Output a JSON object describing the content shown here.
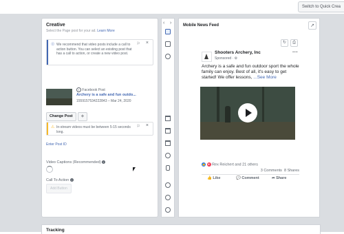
{
  "topbar": {
    "switch_label": "Switch to Quick Crea"
  },
  "creative": {
    "title": "Creative",
    "subtitle": "Select the Page post for your ad.",
    "learn_more": "Learn More",
    "recommend_notice": "We recommend that video posts include a call to action button. You can select an existing post that has a call to action, or create a new video post.",
    "post": {
      "source": "Facebook Post",
      "title": "Archery is a safe and fun outdo...",
      "meta": "1559157534222843 – Mar 24, 2020"
    },
    "change_post": "Change Post",
    "add": "+",
    "instream_notice": "In-stream videos must be between 5-15 seconds long.",
    "enter_post_id": "Enter Post ID",
    "video_captions": "Video Captions (Recommended)",
    "call_to_action": "Call To Action",
    "add_button": "Add Button"
  },
  "preview": {
    "title": "Mobile News Feed",
    "page_name": "Shooters Archery, Inc",
    "sponsored": "Sponsored · ⚙",
    "text": "Archery is a safe and fun outdoor sport the whole family can enjoy. Best of all, it's easy to get started! We offer lessons,",
    "see_more": "...See More",
    "reactions": "Rex Reichert and 21 others",
    "comments": "3 Comments",
    "shares": "8 Shares",
    "like": "Like",
    "comment": "Comment",
    "share": "Share"
  },
  "tracking": {
    "title": "Tracking"
  },
  "colors": {
    "link": "#4267b2",
    "info_bar": "#4267b2",
    "warning_bar": "#f7b928",
    "background": "#dadde1"
  }
}
